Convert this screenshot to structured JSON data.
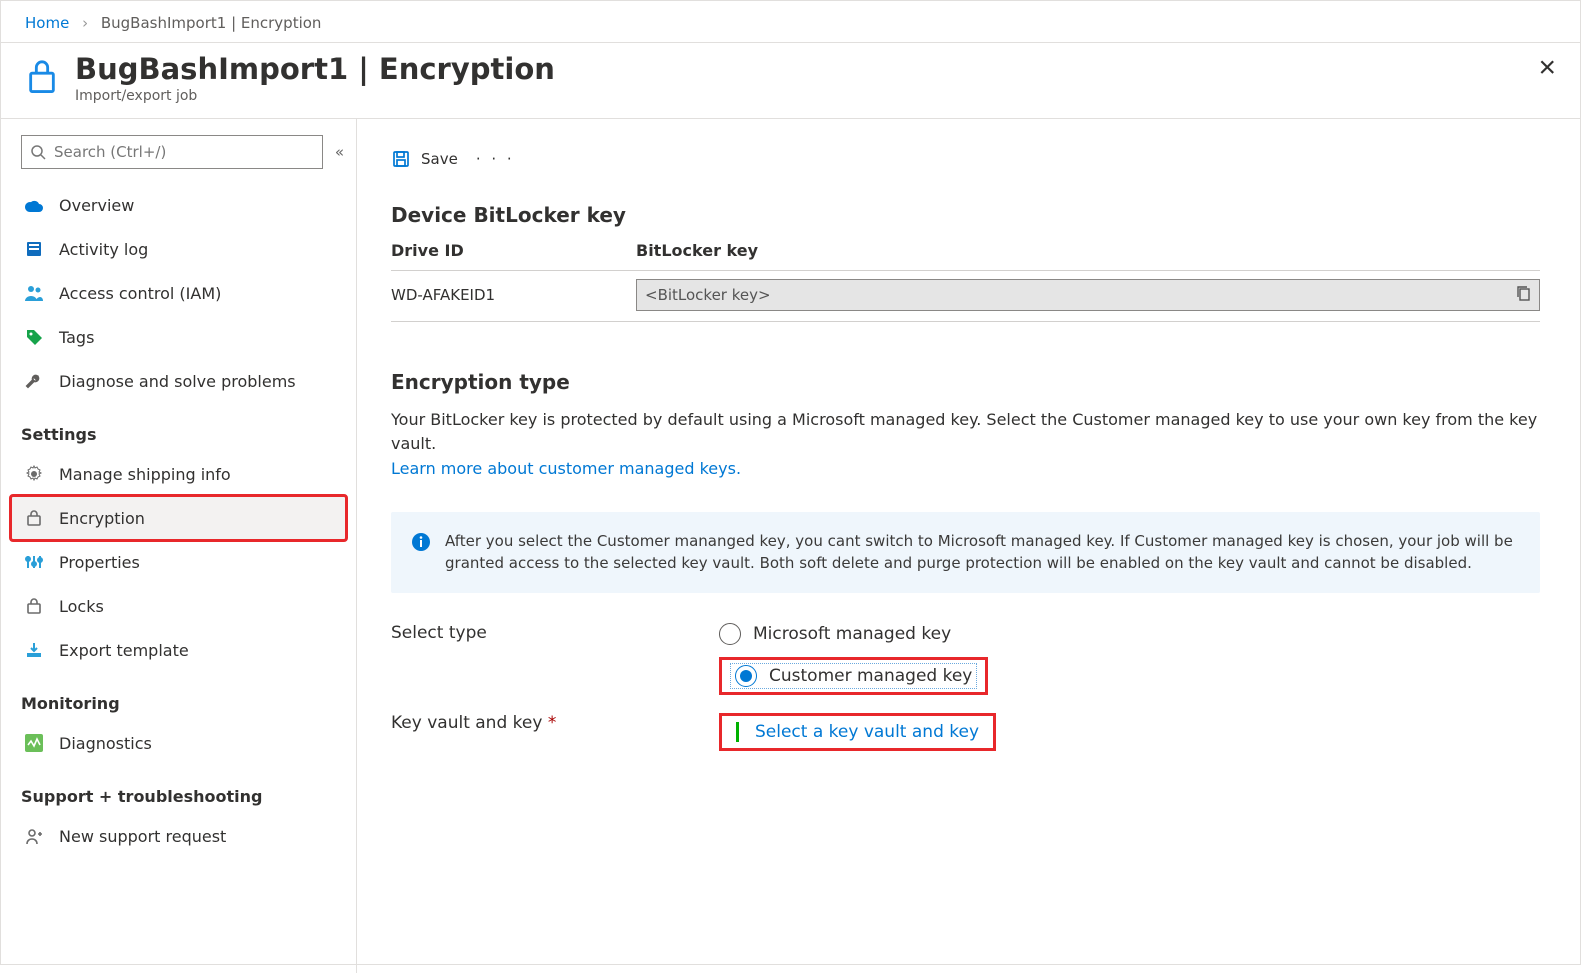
{
  "breadcrumb": {
    "home": "Home",
    "trail": "BugBashImport1 | Encryption"
  },
  "header": {
    "title": "BugBashImport1 | Encryption",
    "sub": "Import/export job"
  },
  "search": {
    "placeholder": "Search (Ctrl+/)",
    "collapse": "«"
  },
  "nav": {
    "items": [
      {
        "label": "Overview",
        "icon": "cloud"
      },
      {
        "label": "Activity log",
        "icon": "log"
      },
      {
        "label": "Access control (IAM)",
        "icon": "people"
      },
      {
        "label": "Tags",
        "icon": "tag"
      },
      {
        "label": "Diagnose and solve problems",
        "icon": "wrench"
      }
    ],
    "settings_label": "Settings",
    "settings": [
      {
        "label": "Manage shipping info",
        "icon": "gear"
      },
      {
        "label": "Encryption",
        "icon": "lock",
        "active": true
      },
      {
        "label": "Properties",
        "icon": "sliders"
      },
      {
        "label": "Locks",
        "icon": "lock"
      },
      {
        "label": "Export template",
        "icon": "export"
      }
    ],
    "monitoring_label": "Monitoring",
    "monitoring": [
      {
        "label": "Diagnostics",
        "icon": "diag"
      }
    ],
    "support_label": "Support + troubleshooting",
    "support": [
      {
        "label": "New support request",
        "icon": "support"
      }
    ]
  },
  "toolbar": {
    "save": "Save",
    "more": "· · ·"
  },
  "bitlocker": {
    "heading": "Device BitLocker key",
    "col_drive": "Drive ID",
    "col_key": "BitLocker key",
    "rows": [
      {
        "drive": "WD-AFAKEID1",
        "key": "<BitLocker key>"
      }
    ]
  },
  "enc": {
    "heading": "Encryption type",
    "desc": "Your BitLocker key is protected by default using a Microsoft managed key. Select the Customer managed key to use your own key from the key vault.",
    "learn": "Learn more about customer managed keys.",
    "info": "After you select the Customer mananged key, you cant switch to Microsoft managed key. If Customer managed key is chosen, your job will be granted access to the selected key vault. Both soft delete and purge protection will be enabled on the key vault and cannot be disabled.",
    "select_label": "Select type",
    "opt_ms": "Microsoft managed key",
    "opt_cmk": "Customer managed key",
    "kv_label": "Key vault and key",
    "kv_req": "*",
    "kv_link": "Select a key vault and key"
  }
}
